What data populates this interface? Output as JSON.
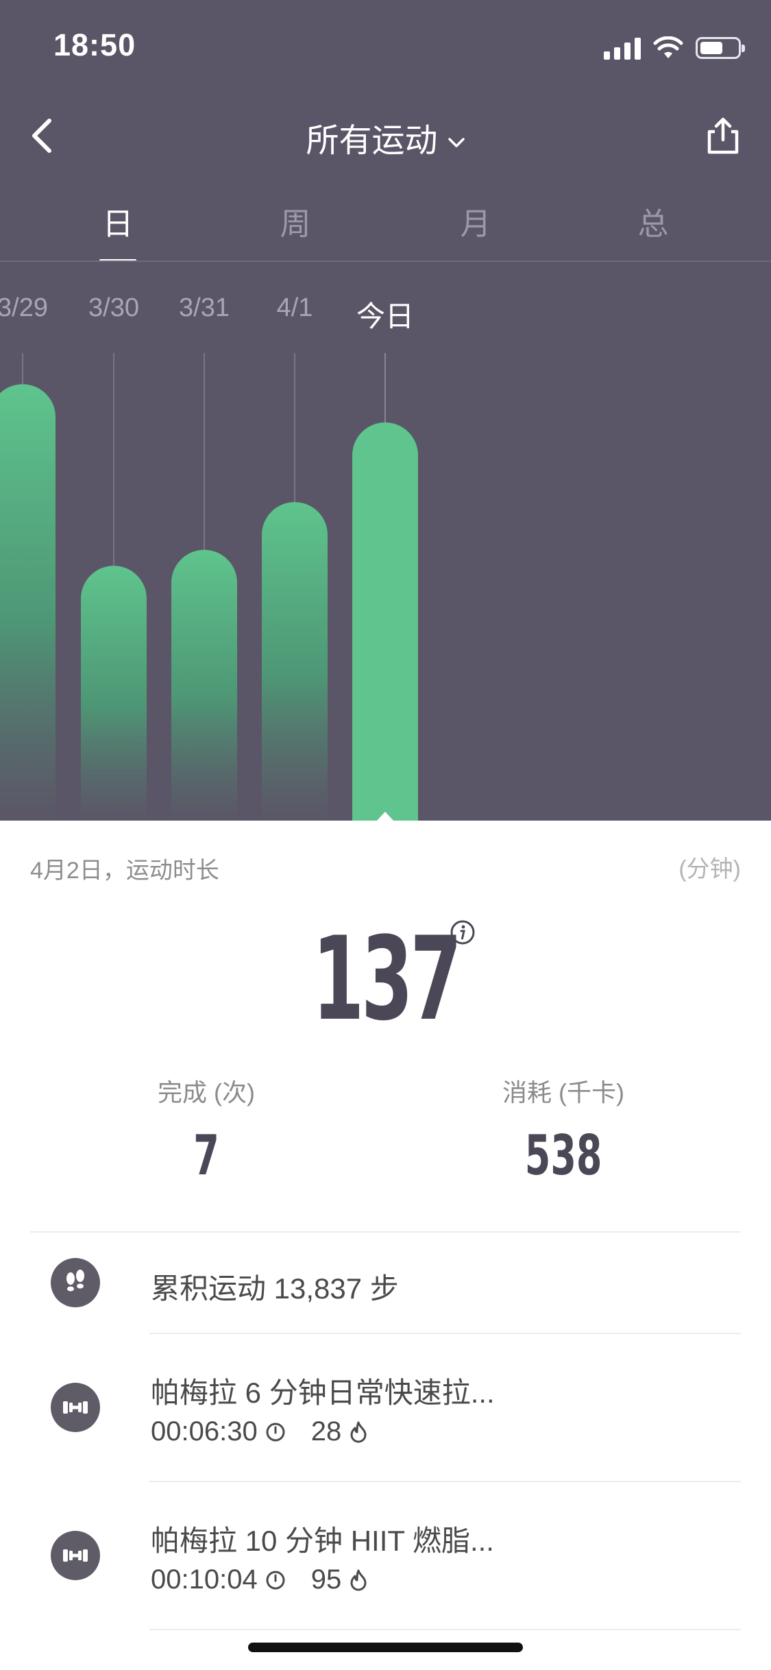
{
  "status_bar": {
    "time": "18:50"
  },
  "header": {
    "title": "所有运动"
  },
  "tabs": [
    {
      "label": "日",
      "active": true
    },
    {
      "label": "周",
      "active": false
    },
    {
      "label": "月",
      "active": false
    },
    {
      "label": "总",
      "active": false
    }
  ],
  "chart_data": {
    "type": "bar",
    "categories": [
      "3/29",
      "3/30",
      "3/31",
      "4/1",
      "今日"
    ],
    "values": [
      137,
      80,
      85,
      100,
      125
    ],
    "selected": "今日",
    "ylim": [
      0,
      150
    ],
    "colors": {
      "bar": "#5fc48d",
      "background": "#5b5667"
    }
  },
  "summary": {
    "date_label": "4月2日，运动时长",
    "unit_label": "(分钟)",
    "value": "137",
    "stats": [
      {
        "label": "完成 (次)",
        "value": "7"
      },
      {
        "label": "消耗 (千卡)",
        "value": "538"
      }
    ]
  },
  "activities": [
    {
      "icon": "footsteps-icon",
      "title": "累积运动 13,837 步"
    },
    {
      "icon": "dumbbell-icon",
      "title": "帕梅拉 6 分钟日常快速拉...",
      "duration": "00:06:30",
      "calories": "28"
    },
    {
      "icon": "dumbbell-icon",
      "title": "帕梅拉 10 分钟 HIIT 燃脂...",
      "duration": "00:10:04",
      "calories": "95"
    }
  ]
}
